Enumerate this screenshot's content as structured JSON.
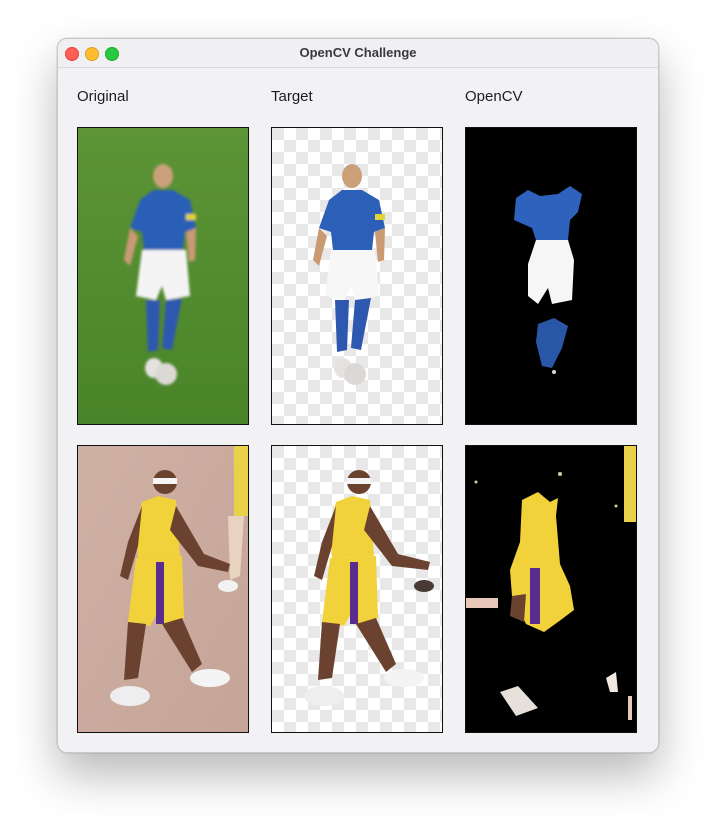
{
  "window": {
    "title": "OpenCV Challenge"
  },
  "columns": {
    "original": "Original",
    "target": "Target",
    "opencv": "OpenCV"
  },
  "rows": [
    {
      "subject": "soccer player in blue jersey and white shorts"
    },
    {
      "subject": "basketball player in yellow and purple uniform"
    }
  ],
  "colors": {
    "grass": "#4f8a2e",
    "court": "#c9a99c",
    "mask_background": "#000000",
    "checker_light": "#ffffff",
    "checker_dark": "#e6e6e6",
    "jersey_blue": "#2c5fb8",
    "jersey_yellow": "#f2d23a",
    "trim_purple": "#5b2c8f"
  }
}
